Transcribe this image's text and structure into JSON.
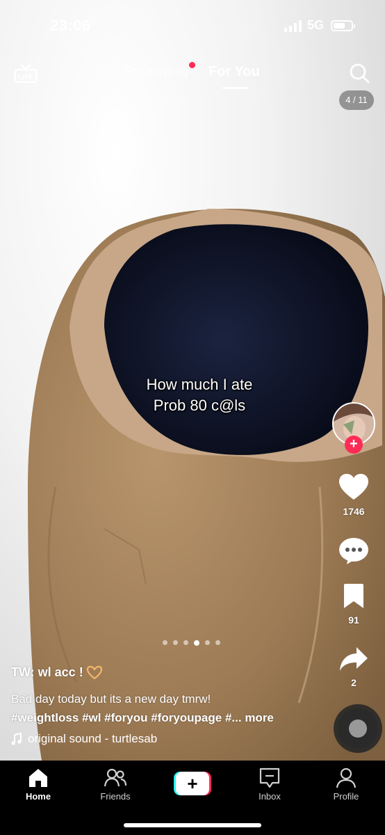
{
  "status_bar": {
    "time": "23:06",
    "network": "5G"
  },
  "top_nav": {
    "live_label": "LIVE",
    "tabs": [
      {
        "label": "Following"
      },
      {
        "label": "For You"
      }
    ],
    "active_tab": "For You",
    "page_counter": "4 / 11"
  },
  "video": {
    "overlay_text": [
      "How much I ate",
      "Prob 80 c@ls"
    ],
    "slideshow": {
      "total": 6,
      "current": 4
    }
  },
  "actions": {
    "likes": "1746",
    "comments": "",
    "bookmarks": "91",
    "shares": "2"
  },
  "caption": {
    "username": "TW: wl acc !",
    "description": "Bad day today but its a new day tmrw!",
    "hashtags": "#weightloss #wl #foryou #foryoupage #...",
    "more": "more",
    "sound": "original sound - turtlesab"
  },
  "bottom_nav": {
    "items": [
      {
        "label": "Home",
        "icon": "home-icon"
      },
      {
        "label": "Friends",
        "icon": "friends-icon"
      },
      {
        "label": "",
        "icon": "plus-icon"
      },
      {
        "label": "Inbox",
        "icon": "inbox-icon"
      },
      {
        "label": "Profile",
        "icon": "profile-icon"
      }
    ]
  },
  "colors": {
    "accent": "#fe2c55",
    "cyan": "#25f4ee",
    "egg": "#a2825e"
  }
}
